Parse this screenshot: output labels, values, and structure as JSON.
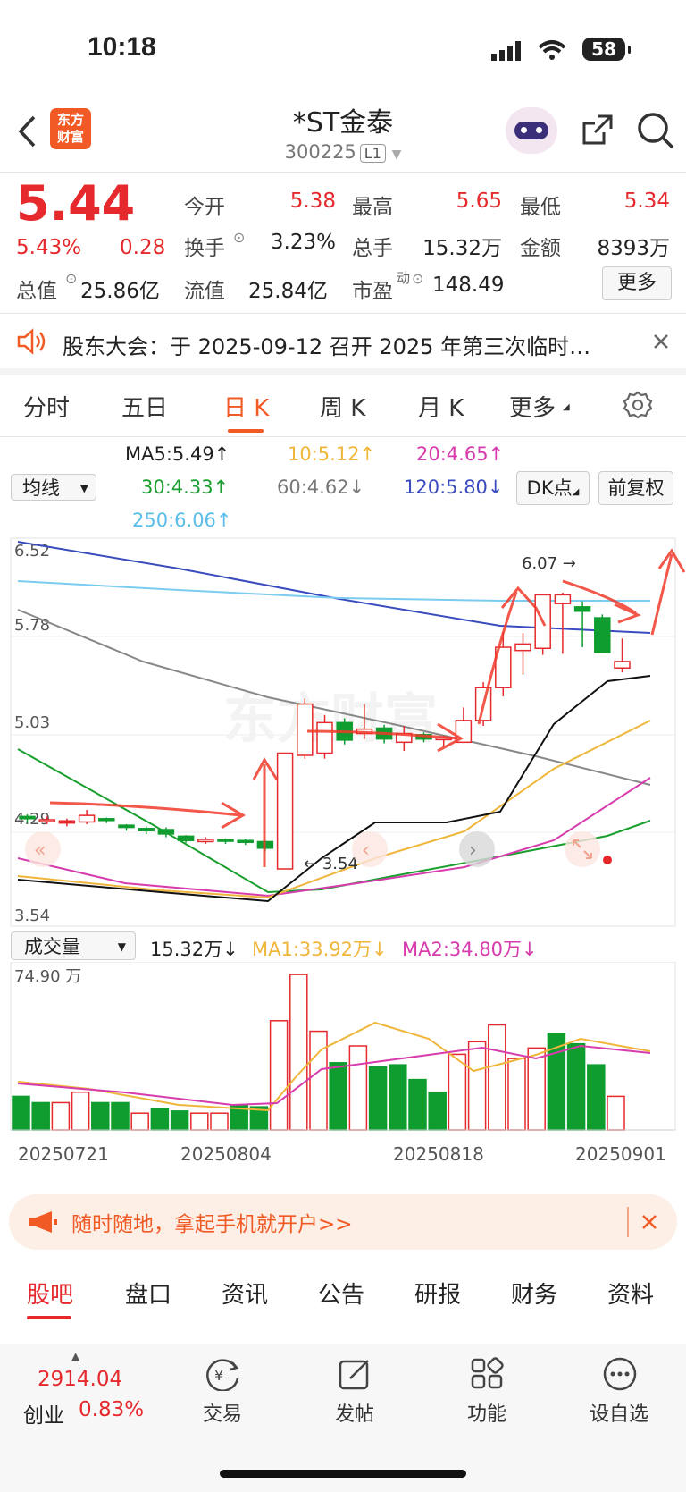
{
  "status_bar": {
    "time": "10:18",
    "battery": "58"
  },
  "header": {
    "title": "*ST金泰",
    "code": "300225",
    "level": "L1",
    "logo_line1": "东方",
    "logo_line2": "财富"
  },
  "quote": {
    "price": "5.44",
    "change_pct": "5.43%",
    "change": "0.28",
    "open_label": "今开",
    "open": "5.38",
    "high_label": "最高",
    "high": "5.65",
    "low_label": "最低",
    "low": "5.34",
    "turnover_label": "换手",
    "turnover": "3.23%",
    "volume_label": "总手",
    "volume": "15.32万",
    "amount_label": "金额",
    "amount": "8393万",
    "mktcap_label": "总值",
    "mktcap": "25.86亿",
    "float_label": "流值",
    "float": "25.84亿",
    "pe_label": "市盈",
    "pe_sup": "动",
    "pe": "148.49",
    "more_button": "更多"
  },
  "notice": {
    "text": "股东大会：于 2025-09-12 召开 2025 年第三次临时…"
  },
  "period_tabs": [
    "分时",
    "五日",
    "日 K",
    "周 K",
    "月 K",
    "更多"
  ],
  "ma_controls": {
    "select": "均线",
    "ma5": "MA5:5.49↑",
    "ma10": "10:5.12↑",
    "ma20": "20:4.65↑",
    "ma30": "30:4.33↑",
    "ma60": "60:4.62↓",
    "ma120": "120:5.80↓",
    "ma250": "250:6.06↑",
    "dk_button": "DK点",
    "fq_button": "前复权"
  },
  "chart": {
    "y_labels": [
      "6.52",
      "5.78",
      "5.03",
      "4.29",
      "3.54"
    ],
    "high_annotation": "6.07",
    "low_annotation": "3.54",
    "watermark": "东方财富"
  },
  "volume_controls": {
    "select": "成交量",
    "vol": "15.32万↓",
    "ma1": "MA1:33.92万↓",
    "ma2": "MA2:34.80万↓",
    "max_label": "74.90 万"
  },
  "x_dates": [
    "20250721",
    "20250804",
    "20250818",
    "20250901"
  ],
  "chart_data": {
    "type": "candlestick",
    "ylim": [
      3.54,
      6.52
    ],
    "candles": [
      {
        "o": 4.02,
        "c": 4.0,
        "h": 4.04,
        "l": 3.96
      },
      {
        "o": 3.98,
        "c": 3.99,
        "h": 4.02,
        "l": 3.95
      },
      {
        "o": 3.96,
        "c": 3.98,
        "h": 4.0,
        "l": 3.93
      },
      {
        "o": 3.97,
        "c": 4.03,
        "h": 4.08,
        "l": 3.95
      },
      {
        "o": 4.0,
        "c": 3.99,
        "h": 4.01,
        "l": 3.96
      },
      {
        "o": 3.94,
        "c": 3.92,
        "h": 3.95,
        "l": 3.89
      },
      {
        "o": 3.91,
        "c": 3.89,
        "h": 3.93,
        "l": 3.86
      },
      {
        "o": 3.9,
        "c": 3.86,
        "h": 3.92,
        "l": 3.83
      },
      {
        "o": 3.84,
        "c": 3.8,
        "h": 3.85,
        "l": 3.78
      },
      {
        "o": 3.79,
        "c": 3.81,
        "h": 3.83,
        "l": 3.77
      },
      {
        "o": 3.81,
        "c": 3.8,
        "h": 3.82,
        "l": 3.77
      },
      {
        "o": 3.8,
        "c": 3.79,
        "h": 3.81,
        "l": 3.76
      },
      {
        "o": 3.79,
        "c": 3.73,
        "h": 3.8,
        "l": 3.7
      },
      {
        "o": 3.54,
        "c": 4.6,
        "h": 4.6,
        "l": 3.54
      },
      {
        "o": 4.58,
        "c": 5.05,
        "h": 5.1,
        "l": 4.55
      },
      {
        "o": 4.6,
        "c": 4.88,
        "h": 4.95,
        "l": 4.55
      },
      {
        "o": 4.88,
        "c": 4.72,
        "h": 4.92,
        "l": 4.68
      },
      {
        "o": 4.78,
        "c": 4.82,
        "h": 5.05,
        "l": 4.73
      },
      {
        "o": 4.83,
        "c": 4.73,
        "h": 4.86,
        "l": 4.69
      },
      {
        "o": 4.7,
        "c": 4.78,
        "h": 4.85,
        "l": 4.62
      },
      {
        "o": 4.77,
        "c": 4.73,
        "h": 4.79,
        "l": 4.7
      },
      {
        "o": 4.74,
        "c": 4.74,
        "h": 4.76,
        "l": 4.66
      },
      {
        "o": 4.7,
        "c": 4.9,
        "h": 5.02,
        "l": 4.7
      },
      {
        "o": 4.9,
        "c": 5.2,
        "h": 5.25,
        "l": 4.85
      },
      {
        "o": 5.2,
        "c": 5.57,
        "h": 5.71,
        "l": 5.12
      },
      {
        "o": 5.54,
        "c": 5.6,
        "h": 5.7,
        "l": 5.32
      },
      {
        "o": 5.56,
        "c": 6.05,
        "h": 6.05,
        "l": 5.5
      },
      {
        "o": 5.97,
        "c": 6.05,
        "h": 6.07,
        "l": 5.51
      },
      {
        "o": 5.94,
        "c": 5.9,
        "h": 5.99,
        "l": 5.57
      },
      {
        "o": 5.84,
        "c": 5.52,
        "h": 5.87,
        "l": 5.52
      },
      {
        "o": 5.38,
        "c": 5.44,
        "h": 5.65,
        "l": 5.34
      }
    ],
    "volume_max": 74.9,
    "volume": [
      16,
      13,
      13,
      18,
      13,
      13,
      8,
      10,
      9,
      8,
      8,
      12,
      11,
      52,
      74,
      47,
      32,
      40,
      30,
      31,
      24,
      18,
      36,
      42,
      50,
      34,
      39,
      46,
      41,
      31,
      16
    ],
    "up": [
      false,
      false,
      true,
      true,
      false,
      false,
      true,
      false,
      false,
      true,
      true,
      false,
      false,
      true,
      true,
      true,
      false,
      true,
      false,
      false,
      false,
      false,
      true,
      true,
      true,
      true,
      true,
      false,
      false,
      false,
      true
    ]
  },
  "banner": {
    "text": "随时随地，拿起手机就开户>>"
  },
  "content_tabs": [
    "股吧",
    "盘口",
    "资讯",
    "公告",
    "研报",
    "财务",
    "资料"
  ],
  "bottom_nav": {
    "index_value": "2914.04",
    "index_name": "创业",
    "index_change": "0.83%",
    "trade": "交易",
    "post": "发帖",
    "func": "功能",
    "watchlist": "设自选"
  },
  "colors": {
    "up": "#e5292c",
    "down": "#0f9d2f",
    "accent": "#f15a24"
  }
}
